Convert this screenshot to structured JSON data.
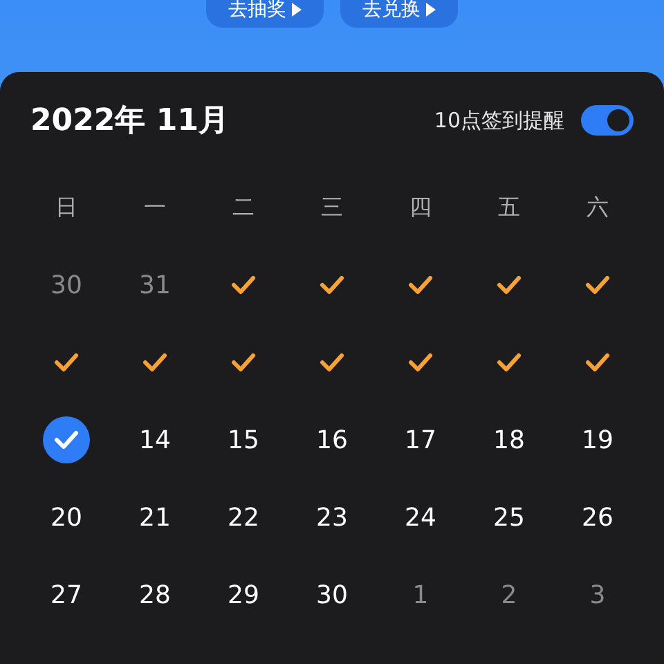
{
  "top_buttons": [
    {
      "label": "去抽奖"
    },
    {
      "label": "去兑换"
    }
  ],
  "calendar": {
    "title": "2022年 11月",
    "reminder": {
      "label": "10点签到提醒",
      "on": true
    },
    "weekdays": [
      "日",
      "一",
      "二",
      "三",
      "四",
      "五",
      "六"
    ],
    "days": [
      {
        "kind": "date",
        "text": "30",
        "muted": true
      },
      {
        "kind": "date",
        "text": "31",
        "muted": true
      },
      {
        "kind": "signed"
      },
      {
        "kind": "signed"
      },
      {
        "kind": "signed"
      },
      {
        "kind": "signed"
      },
      {
        "kind": "signed"
      },
      {
        "kind": "signed"
      },
      {
        "kind": "signed"
      },
      {
        "kind": "signed"
      },
      {
        "kind": "signed"
      },
      {
        "kind": "signed"
      },
      {
        "kind": "signed"
      },
      {
        "kind": "signed"
      },
      {
        "kind": "today"
      },
      {
        "kind": "date",
        "text": "14",
        "muted": false
      },
      {
        "kind": "date",
        "text": "15",
        "muted": false
      },
      {
        "kind": "date",
        "text": "16",
        "muted": false
      },
      {
        "kind": "date",
        "text": "17",
        "muted": false
      },
      {
        "kind": "date",
        "text": "18",
        "muted": false
      },
      {
        "kind": "date",
        "text": "19",
        "muted": false
      },
      {
        "kind": "date",
        "text": "20",
        "muted": false
      },
      {
        "kind": "date",
        "text": "21",
        "muted": false
      },
      {
        "kind": "date",
        "text": "22",
        "muted": false
      },
      {
        "kind": "date",
        "text": "23",
        "muted": false
      },
      {
        "kind": "date",
        "text": "24",
        "muted": false
      },
      {
        "kind": "date",
        "text": "25",
        "muted": false
      },
      {
        "kind": "date",
        "text": "26",
        "muted": false
      },
      {
        "kind": "date",
        "text": "27",
        "muted": false
      },
      {
        "kind": "date",
        "text": "28",
        "muted": false
      },
      {
        "kind": "date",
        "text": "29",
        "muted": false
      },
      {
        "kind": "date",
        "text": "30",
        "muted": false
      },
      {
        "kind": "date",
        "text": "1",
        "muted": true
      },
      {
        "kind": "date",
        "text": "2",
        "muted": true
      },
      {
        "kind": "date",
        "text": "3",
        "muted": true
      }
    ]
  }
}
